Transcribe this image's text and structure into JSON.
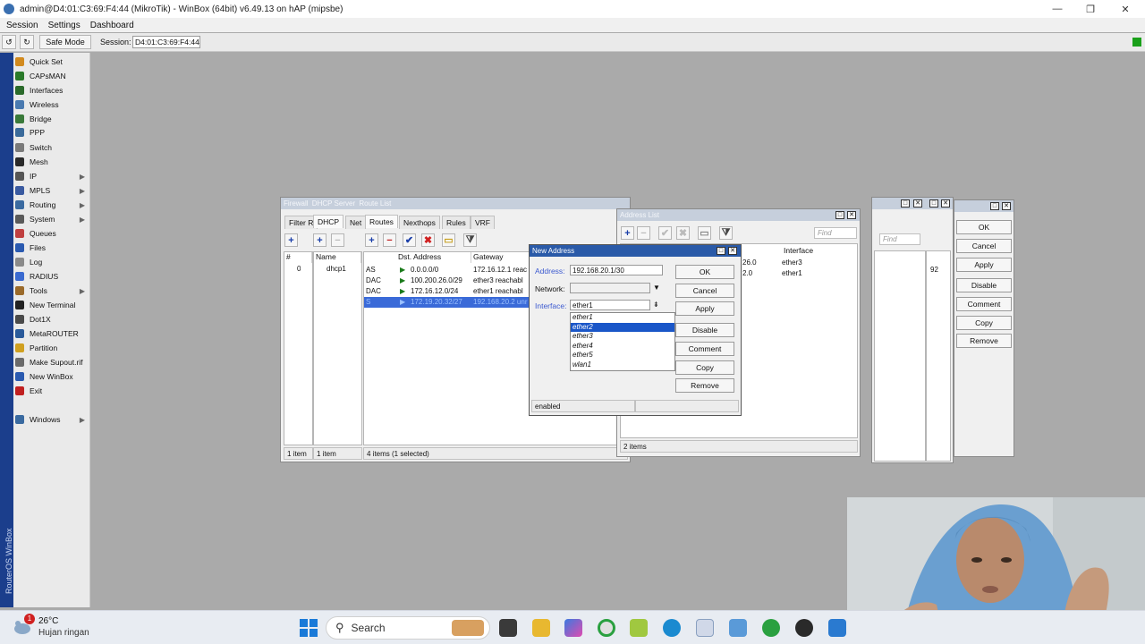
{
  "window": {
    "title": "admin@D4:01:C3:69:F4:44 (MikroTik) - WinBox (64bit) v6.49.13 on hAP (mipsbe)",
    "minimize": "—",
    "restore": "❐",
    "close": "✕"
  },
  "menubar": [
    "Session",
    "Settings",
    "Dashboard"
  ],
  "toolbar": {
    "undo": "↺",
    "redo": "↻",
    "safe_mode": "Safe Mode",
    "session_label": "Session:",
    "session_value": "D4:01:C3:69:F4:44"
  },
  "sidebar": {
    "vertical_label": "RouterOS WinBox",
    "items": [
      {
        "label": "Quick Set",
        "icon": "quick-set-icon",
        "color": "#d28a1e",
        "arrow": false
      },
      {
        "label": "CAPsMAN",
        "icon": "capsman-icon",
        "color": "#2a7a2a",
        "arrow": false
      },
      {
        "label": "Interfaces",
        "icon": "interfaces-icon",
        "color": "#2a6a2a",
        "arrow": false
      },
      {
        "label": "Wireless",
        "icon": "wireless-icon",
        "color": "#4a7ab0",
        "arrow": false
      },
      {
        "label": "Bridge",
        "icon": "bridge-icon",
        "color": "#3a7a3a",
        "arrow": false
      },
      {
        "label": "PPP",
        "icon": "ppp-icon",
        "color": "#3a6a9a",
        "arrow": false
      },
      {
        "label": "Switch",
        "icon": "switch-icon",
        "color": "#7a7a7a",
        "arrow": false
      },
      {
        "label": "Mesh",
        "icon": "mesh-icon",
        "color": "#2a2a2a",
        "arrow": false
      },
      {
        "label": "IP",
        "icon": "ip-icon",
        "color": "#555555",
        "arrow": true
      },
      {
        "label": "MPLS",
        "icon": "mpls-icon",
        "color": "#3a5aa0",
        "arrow": true
      },
      {
        "label": "Routing",
        "icon": "routing-icon",
        "color": "#3a6aa0",
        "arrow": true
      },
      {
        "label": "System",
        "icon": "system-icon",
        "color": "#5a5a5a",
        "arrow": true
      },
      {
        "label": "Queues",
        "icon": "queues-icon",
        "color": "#c04040",
        "arrow": false
      },
      {
        "label": "Files",
        "icon": "files-icon",
        "color": "#2a5ab0",
        "arrow": false
      },
      {
        "label": "Log",
        "icon": "log-icon",
        "color": "#8a8a8a",
        "arrow": false
      },
      {
        "label": "RADIUS",
        "icon": "radius-icon",
        "color": "#3a6ad0",
        "arrow": false
      },
      {
        "label": "Tools",
        "icon": "tools-icon",
        "color": "#9a6a2a",
        "arrow": true
      },
      {
        "label": "New Terminal",
        "icon": "terminal-icon",
        "color": "#222222",
        "arrow": false
      },
      {
        "label": "Dot1X",
        "icon": "dot1x-icon",
        "color": "#4a4a4a",
        "arrow": false
      },
      {
        "label": "MetaROUTER",
        "icon": "metarouter-icon",
        "color": "#2a5a9a",
        "arrow": false
      },
      {
        "label": "Partition",
        "icon": "partition-icon",
        "color": "#d0a020",
        "arrow": false
      },
      {
        "label": "Make Supout.rif",
        "icon": "supout-icon",
        "color": "#6a6a6a",
        "arrow": false
      },
      {
        "label": "New WinBox",
        "icon": "winbox-icon",
        "color": "#2a5ab0",
        "arrow": false
      },
      {
        "label": "Exit",
        "icon": "exit-icon",
        "color": "#c02020",
        "arrow": false
      },
      {
        "label": "Windows",
        "icon": "windows-icon",
        "color": "#3a6aa0",
        "arrow": true
      }
    ]
  },
  "route_window": {
    "titles": [
      "Firewall",
      "DHCP Server",
      "Route List"
    ],
    "dhcp_tabs": [
      "Filter R",
      "DHCP",
      "Net"
    ],
    "route_tabs": [
      "Routes",
      "Nexthops",
      "Rules",
      "VRF"
    ],
    "dhcp_headers": [
      "#",
      "Name"
    ],
    "dhcp_rows": [
      {
        "num": "0",
        "name": "dhcp1"
      }
    ],
    "route_headers": [
      "Dst. Address",
      "Gateway"
    ],
    "route_rows": [
      {
        "flag": "AS",
        "dst": "0.0.0.0/0",
        "gw": "172.16.12.1 reac",
        "selected": false
      },
      {
        "flag": "DAC",
        "dst": "100.200.26.0/29",
        "gw": "ether3 reachabl",
        "selected": false
      },
      {
        "flag": "DAC",
        "dst": "172.16.12.0/24",
        "gw": "ether1 reachabl",
        "selected": false
      },
      {
        "flag": "S",
        "dst": "172.19.20.32/27",
        "gw": "192.168.20.2 unr",
        "selected": true
      }
    ],
    "status_left": "1 item",
    "status_mid": "1 item",
    "status_right": "4 items (1 selected)"
  },
  "address_window": {
    "title": "Address List",
    "find_placeholder": "Find",
    "headers": [
      "Interface"
    ],
    "rows": [
      {
        "addr": "26.0",
        "iface": "ether3"
      },
      {
        "addr": "2.0",
        "iface": "ether1"
      }
    ],
    "status": "2 items"
  },
  "right_window": {
    "find_placeholder": "Find",
    "value": "92",
    "buttons": [
      "OK",
      "Cancel",
      "Apply",
      "Disable",
      "Comment",
      "Copy",
      "Remove"
    ]
  },
  "dialog": {
    "title": "New Address",
    "address_label": "Address:",
    "address_value": "192.168.20.1/30",
    "network_label": "Network:",
    "network_value": "",
    "interface_label": "Interface:",
    "interface_value": "ether1",
    "dropdown_options": [
      "ether1",
      "ether2",
      "ether3",
      "ether4",
      "ether5",
      "wlan1"
    ],
    "dropdown_selected": 1,
    "buttons": [
      "OK",
      "Cancel",
      "Apply",
      "Disable",
      "Comment",
      "Copy",
      "Remove"
    ],
    "status": "enabled"
  },
  "taskbar": {
    "weather_temp": "26°C",
    "weather_desc": "Hujan ringan",
    "weather_badge": "1",
    "search_label": "Search"
  }
}
